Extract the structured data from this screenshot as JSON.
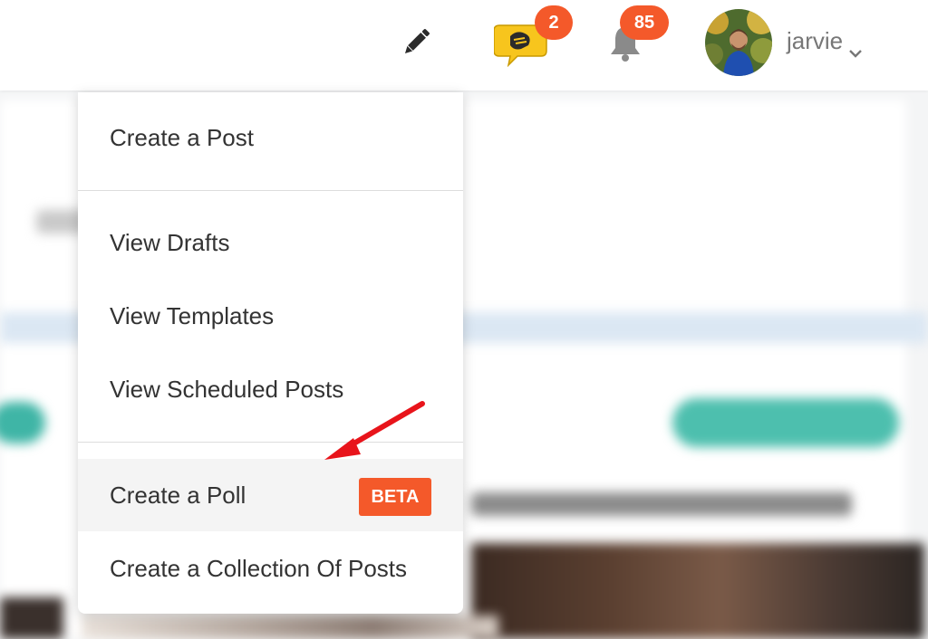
{
  "header": {
    "unread_messages": "2",
    "notifications": "85",
    "username": "jarvie",
    "icons": {
      "compose": "pencil-icon",
      "messages": "chat-bubble-icon",
      "notifications": "bell-icon",
      "user_menu": "chevron-down-icon"
    }
  },
  "create_menu": {
    "items": [
      {
        "label": "Create a Post"
      },
      {
        "label": "View Drafts"
      },
      {
        "label": "View Templates"
      },
      {
        "label": "View Scheduled Posts"
      },
      {
        "label": "Create a Poll",
        "badge": "BETA",
        "highlighted": true
      },
      {
        "label": "Create a Collection Of Posts"
      }
    ]
  },
  "colors": {
    "badge": "#f4592a",
    "chat_icon": "#f7c51d",
    "arrow": "#e8141b",
    "text": "#333333",
    "muted": "#777777"
  }
}
